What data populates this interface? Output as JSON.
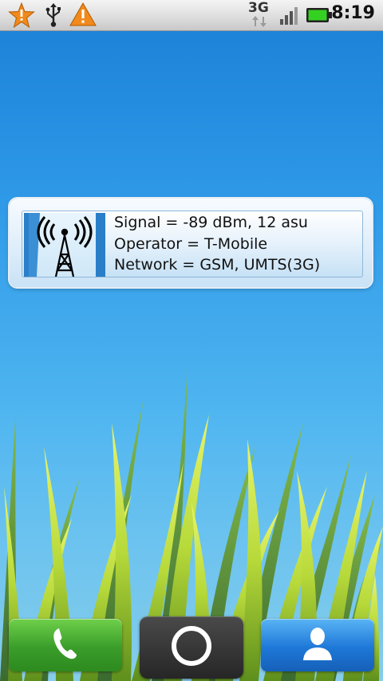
{
  "status_bar": {
    "notification_icons": [
      "starred-notification-icon",
      "usb-icon",
      "warning-icon"
    ],
    "network_type": "3G",
    "signal_icon": "signal-bars-icon",
    "battery_icon": "battery-icon",
    "time": "8:19"
  },
  "widget": {
    "icon": "cell-tower-icon",
    "lines": {
      "signal": "Signal = -89 dBm, 12 asu",
      "operator": "Operator = T-Mobile",
      "network": "Network = GSM, UMTS(3G)"
    }
  },
  "dock": {
    "phone_icon": "phone-icon",
    "home_icon": "launcher-circle-icon",
    "contacts_icon": "contact-person-icon"
  },
  "colors": {
    "phone_button": "#3a9d2a",
    "contacts_button": "#1e78d8",
    "wallpaper_top": "#1a7fd6"
  }
}
